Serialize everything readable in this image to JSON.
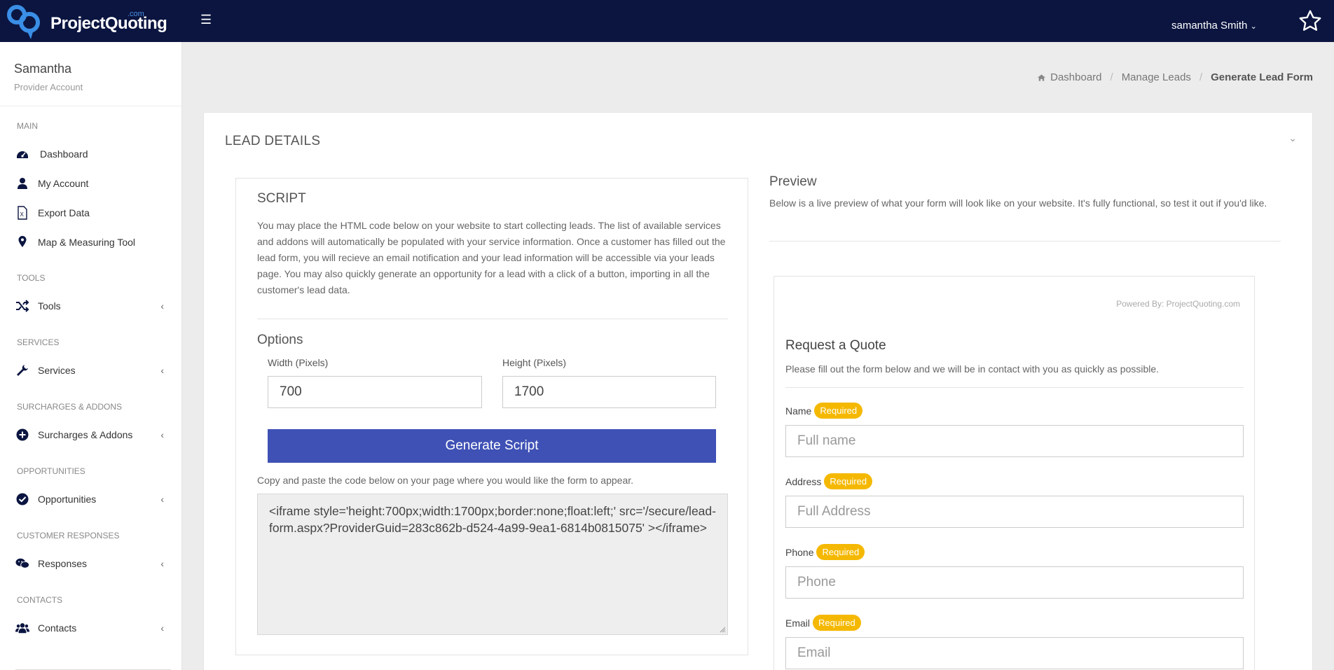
{
  "brand": {
    "name": "ProjectQuoting",
    "suffix": ".com"
  },
  "header": {
    "user_name": "samantha Smith"
  },
  "profile": {
    "name": "Samantha",
    "role": "Provider Account"
  },
  "sidebar": {
    "sections": [
      {
        "heading": "MAIN"
      },
      {
        "heading": "TOOLS"
      },
      {
        "heading": "SERVICES"
      },
      {
        "heading": "SURCHARGES & ADDONS"
      },
      {
        "heading": "OPPORTUNITIES"
      },
      {
        "heading": "CUSTOMER RESPONSES"
      },
      {
        "heading": "CONTACTS"
      }
    ],
    "items": [
      {
        "label": "Dashboard",
        "icon": "dashboard-icon"
      },
      {
        "label": "My Account",
        "icon": "user-icon"
      },
      {
        "label": "Export Data",
        "icon": "excel-file-icon"
      },
      {
        "label": "Map & Measuring Tool",
        "icon": "map-marker-icon"
      },
      {
        "label": "Tools",
        "icon": "shuffle-icon"
      },
      {
        "label": "Services",
        "icon": "wrench-icon"
      },
      {
        "label": "Surcharges & Addons",
        "icon": "plus-circle-icon"
      },
      {
        "label": "Opportunities",
        "icon": "check-circle-icon"
      },
      {
        "label": "Responses",
        "icon": "chat-icon"
      },
      {
        "label": "Contacts",
        "icon": "users-icon"
      }
    ]
  },
  "breadcrumb": {
    "home": "Dashboard",
    "middle": "Manage Leads",
    "current": "Generate Lead Form"
  },
  "card": {
    "title": "LEAD DETAILS"
  },
  "script": {
    "title": "SCRIPT",
    "description": "You may place the HTML code below on your website to start collecting leads. The list of available services and addons will automatically be populated with your service information. Once a customer has filled out the lead form, you will recieve an email notification and your lead information will be accessible via your leads page. You may also quickly generate an opportunity for a lead with a click of a button, importing in all the customer's lead data.",
    "options_title": "Options",
    "width_label": "Width (Pixels)",
    "width_value": "700",
    "height_label": "Height (Pixels)",
    "height_value": "1700",
    "generate_label": "Generate Script",
    "copy_note": "Copy and paste the code below on your page where you would like the form to appear.",
    "code": "<iframe style='height:700px;width:1700px;border:none;float:left;' src='/secure/lead-form.aspx?ProviderGuid=283c862b-d524-4a99-9ea1-6814b0815075' ></iframe>"
  },
  "preview": {
    "title": "Preview",
    "description": "Below is a live preview of what your form will look like on your website. It's fully functional, so test it out if you'd like.",
    "powered_by": "Powered By: ProjectQuoting.com",
    "form_title": "Request a Quote",
    "form_desc": "Please fill out the form below and we will be in contact with you as quickly as possible.",
    "required_badge": "Required",
    "fields": [
      {
        "label": "Name",
        "placeholder": "Full name"
      },
      {
        "label": "Address",
        "placeholder": "Full Address"
      },
      {
        "label": "Phone",
        "placeholder": "Phone"
      },
      {
        "label": "Email",
        "placeholder": "Email"
      }
    ]
  },
  "colors": {
    "topbar": "#0b1540",
    "accent_button": "#3f51b5",
    "required_badge": "#f5b800"
  }
}
